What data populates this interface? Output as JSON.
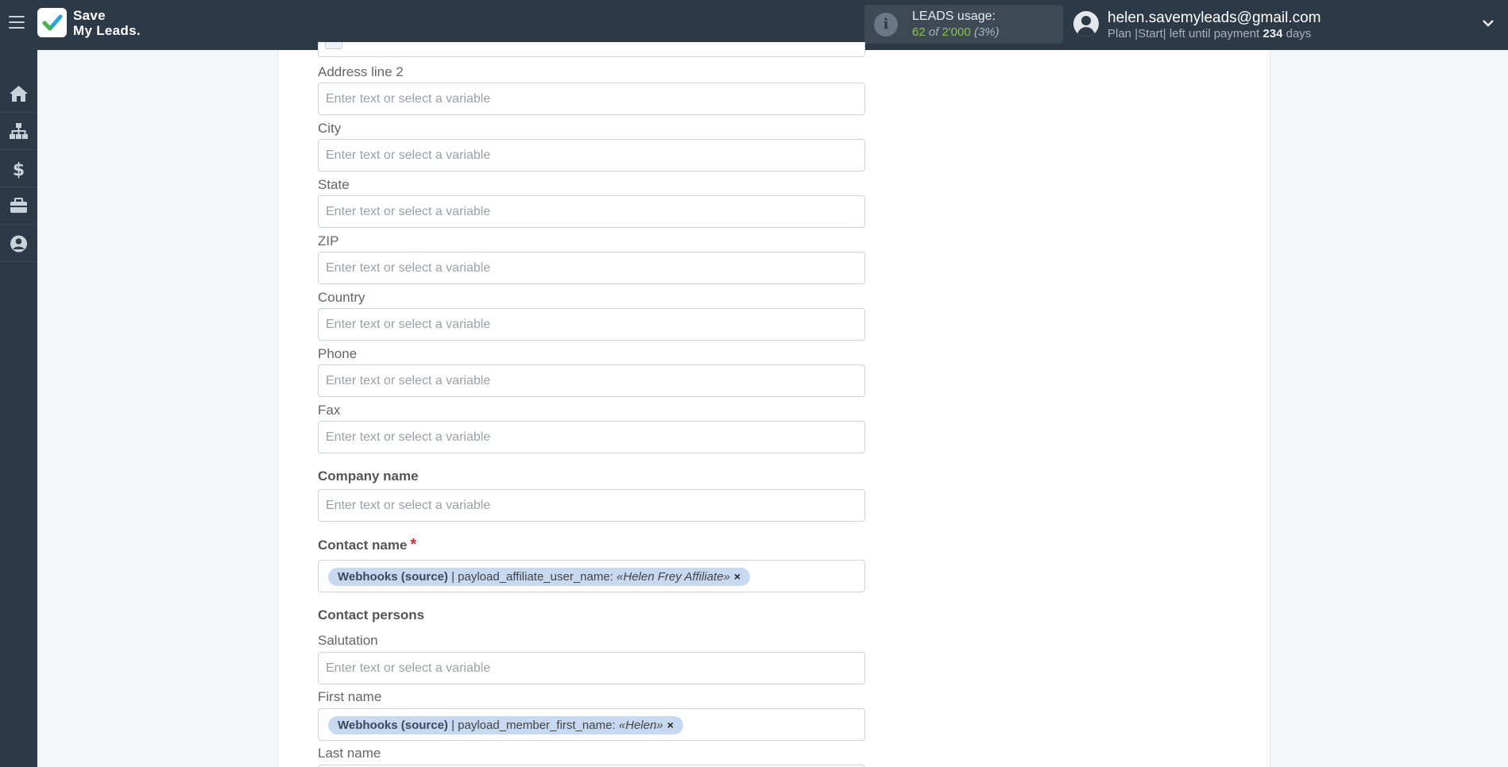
{
  "header": {
    "logo_line1": "Save",
    "logo_line2": "My Leads.",
    "usage": {
      "title": "LEADS usage:",
      "used": "62",
      "of": "of",
      "total": "2'000",
      "percent": "(3%)"
    },
    "user": {
      "email": "helen.savemyleads@gmail.com",
      "plan_text": "Plan |Start| left until payment",
      "days_count": "234",
      "days_label": "days"
    }
  },
  "sidebar": {
    "items": [
      {
        "icon": "home-icon"
      },
      {
        "icon": "sitemap-icon"
      },
      {
        "icon": "dollar-icon"
      },
      {
        "icon": "briefcase-icon"
      },
      {
        "icon": "user-circle-icon"
      }
    ]
  },
  "form": {
    "placeholder": "Enter text or select a variable",
    "address_line2_label": "Address line 2",
    "city_label": "City",
    "state_label": "State",
    "zip_label": "ZIP",
    "country_label": "Country",
    "phone_label": "Phone",
    "fax_label": "Fax",
    "company_name_label": "Company name",
    "contact_name_label": "Contact name",
    "required_mark": "*",
    "contact_name_tag": {
      "source": "Webhooks (source)",
      "separator": " | ",
      "field": "payload_affiliate_user_name:",
      "value": "«Helen Frey Affiliate»",
      "remove": "×"
    },
    "contact_persons_label": "Contact persons",
    "salutation_label": "Salutation",
    "first_name_label": "First name",
    "first_name_tag": {
      "source": "Webhooks (source)",
      "separator": " | ",
      "field": "payload_member_first_name:",
      "value": "«Helen»",
      "remove": "×"
    },
    "last_name_label": "Last name"
  }
}
